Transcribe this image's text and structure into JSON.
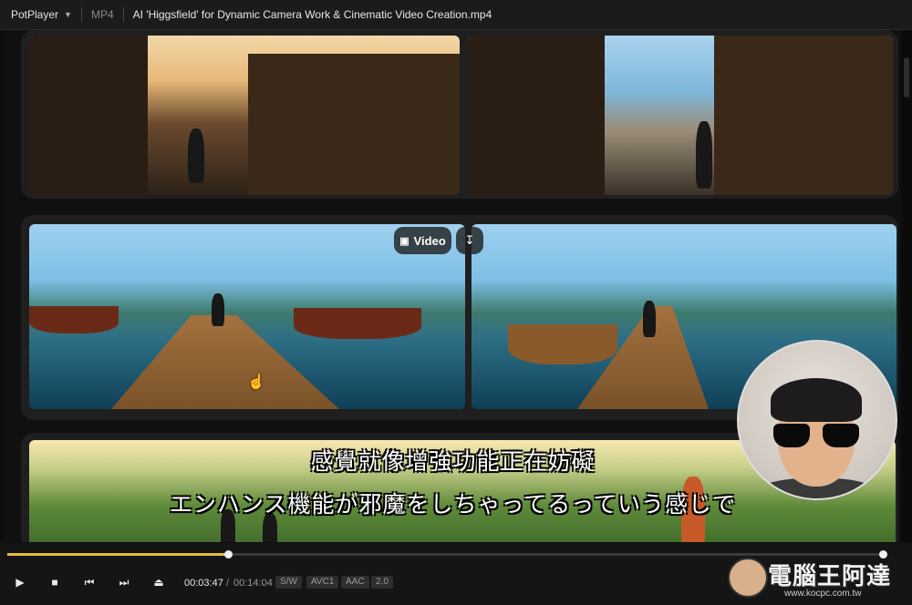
{
  "titlebar": {
    "app_name": "PotPlayer",
    "format": "MP4",
    "file_name": "AI 'Higgsfield' for Dynamic Camera Work & Cinematic Video Creation.mp4"
  },
  "video": {
    "overlay_video_label": "Video",
    "subtitle_line1": "感覺就像增強功能正在妨礙",
    "subtitle_line2": "エンハンス機能が邪魔をしちゃってるっていう感じで"
  },
  "controls": {
    "progress_fraction": 0.2516,
    "current_time": "00:03:47",
    "separator": "/",
    "total_time": "00:14:04",
    "badges": [
      "S/W",
      "AVC1",
      "AAC",
      "2.0"
    ]
  },
  "watermark": {
    "logo_text": "電腦王阿達",
    "url": "www.kocpc.com.tw"
  },
  "colors": {
    "seek_fill": "#e0c040",
    "titlebar_bg": "#1b1b1b",
    "panel_bg": "#1f1f1f"
  }
}
